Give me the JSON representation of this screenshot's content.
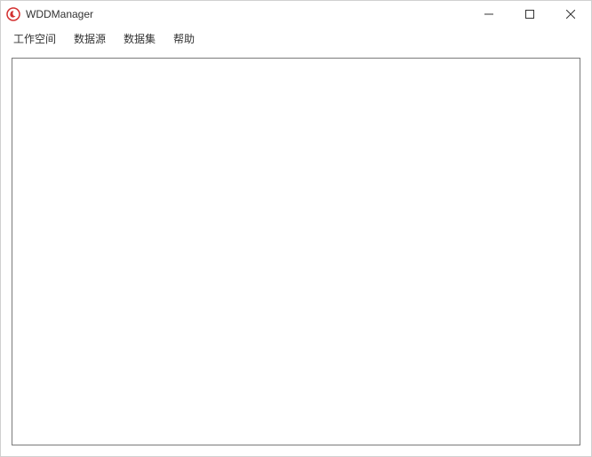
{
  "window": {
    "title": "WDDManager"
  },
  "menu": {
    "items": [
      {
        "label": "工作空间"
      },
      {
        "label": "数据源"
      },
      {
        "label": "数据集"
      },
      {
        "label": "帮助"
      }
    ]
  }
}
